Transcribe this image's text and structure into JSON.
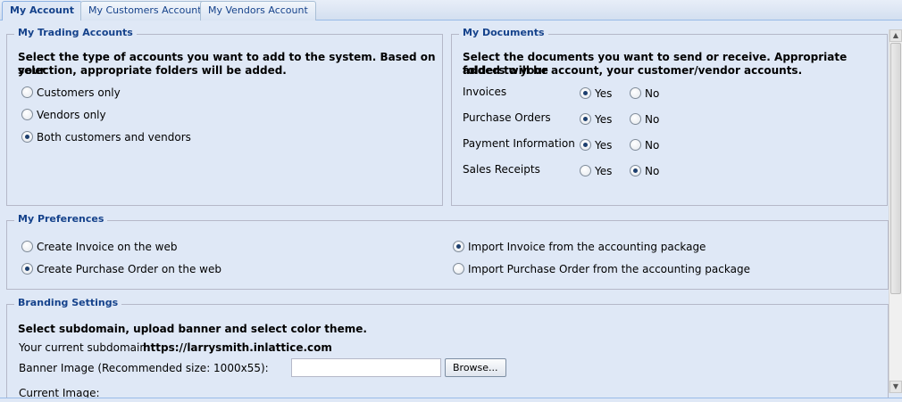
{
  "tabs": [
    {
      "label": "My Account",
      "active": true
    },
    {
      "label": "My Customers Account",
      "active": false
    },
    {
      "label": "My Vendors Account",
      "active": false
    }
  ],
  "trading": {
    "legend": "My Trading Accounts",
    "desc_line1": "Select the type of accounts you want to add to the system. Based on your",
    "desc_line2": "selection, appropriate folders will be added.",
    "options": [
      {
        "label": "Customers only",
        "selected": false
      },
      {
        "label": "Vendors only",
        "selected": false
      },
      {
        "label": "Both customers and vendors",
        "selected": true
      }
    ]
  },
  "documents": {
    "legend": "My Documents",
    "desc_line1": "Select the documents you want to send or receive. Appropriate folders will be",
    "desc_line2": "added to your account, your customer/vendor accounts.",
    "yes_label": "Yes",
    "no_label": "No",
    "rows": [
      {
        "label": "Invoices",
        "value": "Yes"
      },
      {
        "label": "Purchase Orders",
        "value": "Yes"
      },
      {
        "label": "Payment Information",
        "value": "Yes"
      },
      {
        "label": "Sales Receipts",
        "value": "No"
      }
    ]
  },
  "preferences": {
    "legend": "My Preferences",
    "invoice_web": {
      "label": "Create Invoice on the web",
      "selected": false
    },
    "po_web": {
      "label": "Create Purchase Order on the web",
      "selected": true
    },
    "invoice_import": {
      "label": "Import Invoice from the accounting package",
      "selected": true
    },
    "po_import": {
      "label": "Import Purchase Order from the accounting package",
      "selected": false
    }
  },
  "branding": {
    "legend": "Branding Settings",
    "desc": "Select subdomain, upload banner and select color theme.",
    "subdomain_label": "Your current subdomain:",
    "subdomain_value": "https://larrysmith.inlattice.com",
    "banner_label": "Banner Image (Recommended size: 1000x55):",
    "banner_value": "",
    "browse_label": "Browse...",
    "current_image_label": "Current Image:"
  },
  "colors": {
    "accent": "#15428b",
    "panel_bg": "#dfe8f6",
    "border": "#b5b8c8"
  }
}
